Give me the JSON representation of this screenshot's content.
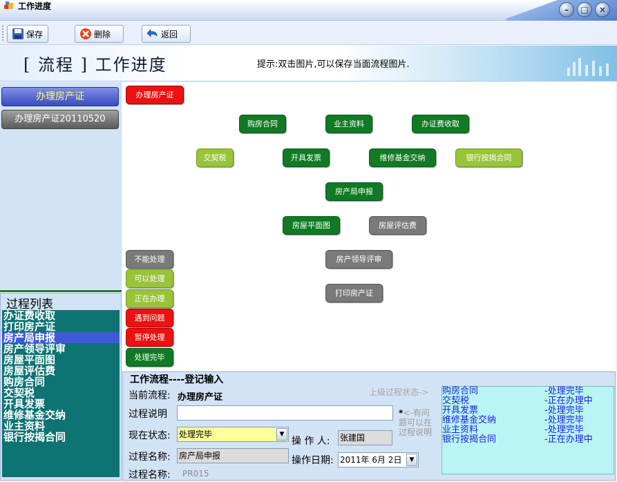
{
  "window": {
    "title": "工作进度",
    "controls": [
      "minimize",
      "maximize",
      "close"
    ]
  },
  "toolbar": {
    "save_label": "保存",
    "delete_label": "删除",
    "back_label": "返回"
  },
  "banner": {
    "title": "[ 流程 ] 工作进度",
    "hint": "提示:双击图片,可以保存当面流程图片."
  },
  "left": {
    "buttons": [
      "办理房产证",
      "办理房产证20110520"
    ]
  },
  "process_list": {
    "header": "过程列表",
    "items": [
      "办证费收取",
      "打印房产证",
      "房产局申报",
      "房产领导评审",
      "房屋平面图",
      "房屋评估费",
      "购房合同",
      "交契税",
      "开具发票",
      "维修基金交纳",
      "业主资料",
      "银行按揭合同"
    ],
    "selected_index": 2
  },
  "flow": {
    "start": "办理房产证",
    "nodes": [
      "购房合同",
      "业主资料",
      "办证费收取",
      "交契税",
      "开具发票",
      "维修基金交纳",
      "银行按揭合同",
      "房产局申报",
      "房屋平面图",
      "房屋评估费",
      "房产领导评审",
      "打印房产证"
    ],
    "legend": [
      "不能处理",
      "可以处理",
      "正在办理",
      "遇到问题",
      "暂停处理",
      "处理完毕"
    ]
  },
  "colors": {
    "done": "#107a24",
    "in_progress": "#98c43a",
    "cannot": "#7a7a7a",
    "problem": "#ee1111"
  },
  "form": {
    "legend": "工作流程----登记输入",
    "current_flow_label": "当前流程:",
    "current_flow_value": "办理房产证",
    "description_label": "过程说明",
    "description_value": "",
    "status_label": "现在状态:",
    "status_value": "处理完毕",
    "operator_label": "操 作 人:",
    "operator_value": "张建国",
    "process_name_label": "过程名称:",
    "process_name_value": "房产局申报",
    "date_label": "操作日期:",
    "date_value": "2011年 6月 2日",
    "process_code_label": "过程名称:",
    "process_code_value": "PR015",
    "upper_status_label": "上级过程状态->",
    "star": "*",
    "note": "<-有问题可以在过程说明",
    "upper_status": [
      {
        "name": "购房合同",
        "status": "-处理完毕"
      },
      {
        "name": "交契税",
        "status": "-正在办理中"
      },
      {
        "name": "开具发票",
        "status": "-处理完毕"
      },
      {
        "name": "维修基金交纳",
        "status": "-处理完毕"
      },
      {
        "name": "业主资料",
        "status": "-处理完毕"
      },
      {
        "name": "银行按揭合同",
        "status": "-正在办理中"
      }
    ]
  }
}
